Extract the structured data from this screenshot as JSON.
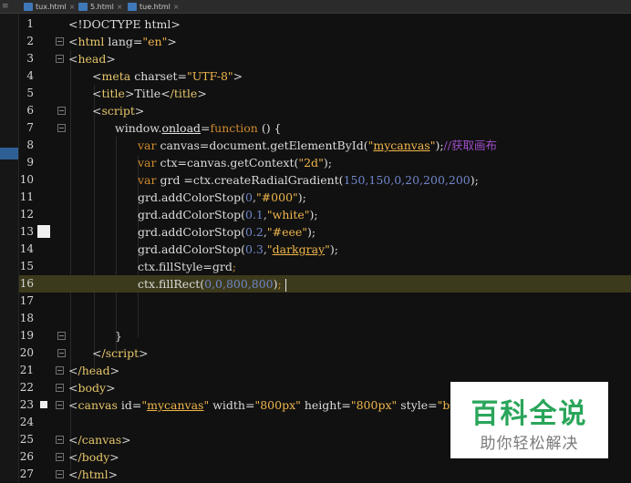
{
  "tabs": [
    {
      "label": "tux.html"
    },
    {
      "label": "5.html"
    },
    {
      "label": "tue.html"
    }
  ],
  "line_numbers": [
    "1",
    "2",
    "3",
    "4",
    "5",
    "6",
    "7",
    "8",
    "9",
    "10",
    "11",
    "12",
    "13",
    "14",
    "15",
    "16",
    "17",
    "18",
    "19",
    "20",
    "21",
    "22",
    "23",
    "24",
    "25",
    "26",
    "27"
  ],
  "code": {
    "l1": {
      "a": "<!DOCTYPE html>"
    },
    "l2": {
      "t": "html",
      "attr": " lang=",
      "v": "\"en\""
    },
    "l3": {
      "t": "head"
    },
    "l4": {
      "t": "meta",
      "attr": " charset=",
      "v": "\"UTF-8\""
    },
    "l5": {
      "t": "title",
      "text": "Title",
      "t2": "/title"
    },
    "l6": {
      "t": "script"
    },
    "l7": {
      "a": "window.",
      "b": "onload",
      "c": "=",
      "d": "function",
      "e": " () {"
    },
    "l8": {
      "a": "var",
      "b": " canvas=document.getElementById(",
      "c": "\"",
      "d": "mycanvas",
      "e": "\"",
      "f": ");",
      "g": "//获取画布"
    },
    "l9": {
      "a": "var",
      "b": " ctx=canvas.getContext(",
      "c": "\"2d\"",
      "d": ");"
    },
    "l10": {
      "a": "var",
      "b": " grd =ctx.createRadialGradient(",
      "c": "150,150,0,20,200,200",
      "d": ");"
    },
    "l11": {
      "a": "grd.addColorStop(",
      "b": "0",
      "c": ",",
      "d": "\"#000\"",
      "e": ");"
    },
    "l12": {
      "a": "grd.addColorStop(",
      "b": "0.1",
      "c": ",",
      "d": "\"white\"",
      "e": ");"
    },
    "l13": {
      "a": "grd.addColorStop(",
      "b": "0.2",
      "c": ",",
      "d": "\"#eee\"",
      "e": ");"
    },
    "l14": {
      "a": "grd.addColorStop(",
      "b": "0.3",
      "c": ",",
      "d": "\"",
      "e": "darkgray",
      "f": "\"",
      "g": ");"
    },
    "l15": {
      "a": "ctx.fillStyle=grd",
      "b": ";"
    },
    "l16": {
      "a": "ctx.fillRect(",
      "b": "0,0,800,800",
      "c": ")",
      "d": ";"
    },
    "l19": {
      "a": "}"
    },
    "l20": {
      "t": "/script"
    },
    "l21": {
      "t": "/head"
    },
    "l22": {
      "t": "body"
    },
    "l23": {
      "t": "canvas",
      "a1": " id=",
      "v1": "\"",
      "v1u": "mycanvas",
      "v1e": "\"",
      "a2": " width=",
      "v2": "\"800px\"",
      "a3": " height=",
      "v3": "\"800px\"",
      "a4": " style=",
      "v4": "\"backg"
    },
    "l25": {
      "t": "/canvas"
    },
    "l26": {
      "t": "/body"
    },
    "l27": {
      "t": "/html"
    }
  },
  "watermark": {
    "title": "百科全说",
    "subtitle": "助你轻松解决"
  },
  "colors": {
    "current_line": "#3c3a1c",
    "watermark_green": "#2aa55a",
    "tab_icon": "#3f78b8"
  }
}
